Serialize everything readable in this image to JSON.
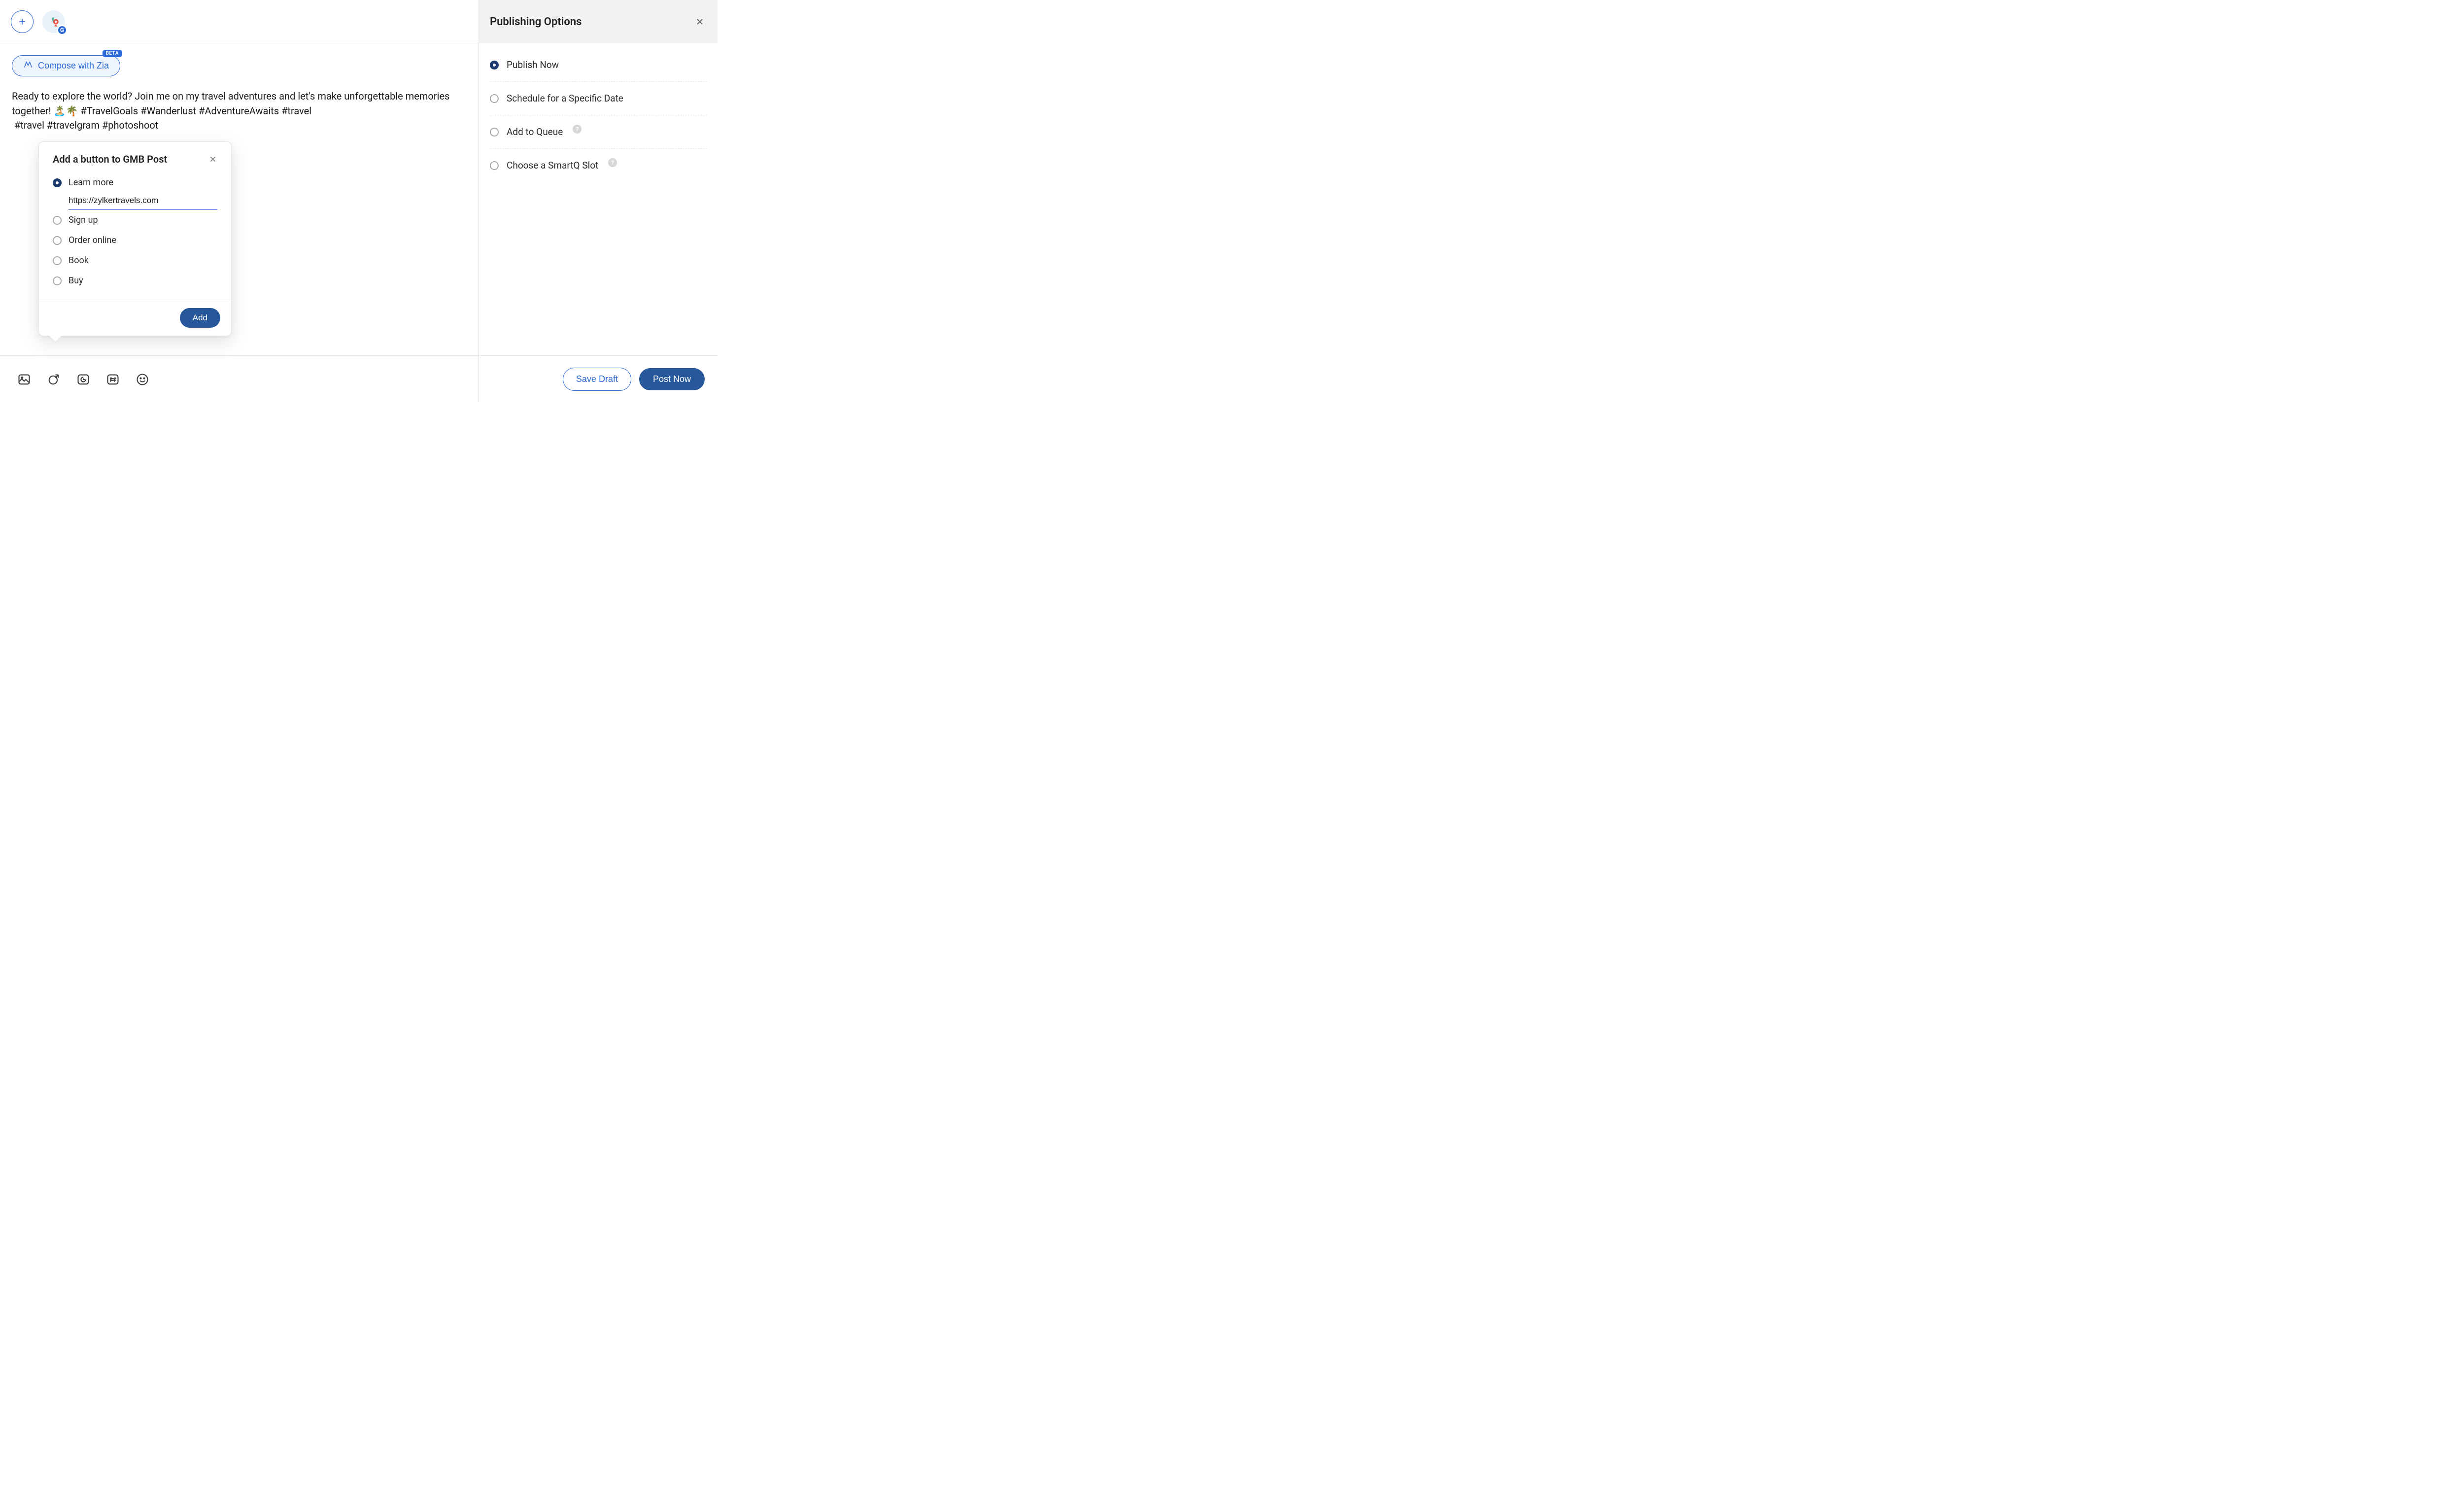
{
  "compose": {
    "zia_label": "Compose with Zia",
    "beta_label": "BETA",
    "post_text": "Ready to explore the world? Join me on my travel adventures and let's make unforgettable memories together! 🏝️🌴 #TravelGoals #Wanderlust #AdventureAwaits #travel\n #travel #travelgram #photoshoot"
  },
  "gmb_popover": {
    "title": "Add a button to GMB Post",
    "options": [
      {
        "label": "Learn more",
        "selected": true
      },
      {
        "label": "Sign up",
        "selected": false
      },
      {
        "label": "Order online",
        "selected": false
      },
      {
        "label": "Book",
        "selected": false
      },
      {
        "label": "Buy",
        "selected": false
      }
    ],
    "url_value": "https://zylkertravels.com",
    "add_label": "Add"
  },
  "publishing": {
    "title": "Publishing Options",
    "options": [
      {
        "label": "Publish Now",
        "selected": true,
        "help": false
      },
      {
        "label": "Schedule for a Specific Date",
        "selected": false,
        "help": false
      },
      {
        "label": "Add to Queue",
        "selected": false,
        "help": true
      },
      {
        "label": "Choose a SmartQ Slot",
        "selected": false,
        "help": true
      }
    ]
  },
  "footer": {
    "save_draft_label": "Save Draft",
    "post_now_label": "Post Now"
  },
  "icons": {
    "channel_badge": "G",
    "help": "?"
  }
}
